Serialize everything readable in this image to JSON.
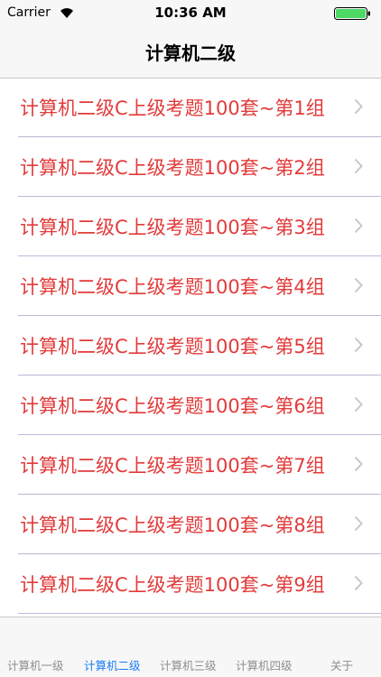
{
  "status": {
    "carrier": "Carrier",
    "time": "10:36 AM"
  },
  "nav": {
    "title": "计算机二级"
  },
  "list": [
    {
      "label": "计算机二级C上级考题100套~第1组"
    },
    {
      "label": "计算机二级C上级考题100套~第2组"
    },
    {
      "label": "计算机二级C上级考题100套~第3组"
    },
    {
      "label": "计算机二级C上级考题100套~第4组"
    },
    {
      "label": "计算机二级C上级考题100套~第5组"
    },
    {
      "label": "计算机二级C上级考题100套~第6组"
    },
    {
      "label": "计算机二级C上级考题100套~第7组"
    },
    {
      "label": "计算机二级C上级考题100套~第8组"
    },
    {
      "label": "计算机二级C上级考题100套~第9组"
    }
  ],
  "tabs": [
    {
      "label": "计算机一级"
    },
    {
      "label": "计算机二级"
    },
    {
      "label": "计算机三级"
    },
    {
      "label": "计算机四级"
    },
    {
      "label": "关于"
    }
  ],
  "colors": {
    "item_text": "#e23b3b",
    "tab_active": "#1a7cf2",
    "tab_inactive": "#8e8e93",
    "battery": "#4cd964"
  }
}
